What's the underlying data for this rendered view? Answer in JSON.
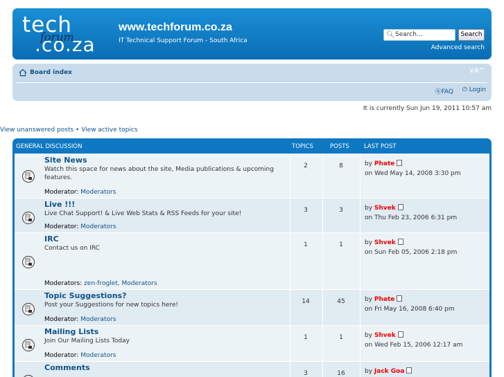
{
  "header": {
    "logo": {
      "line1": "tech",
      "line2": "forum",
      "line3": ".co.za"
    },
    "site_title": "www.techforum.co.za",
    "site_description": "IT Technical Support Forum - South Africa",
    "search_placeholder": "Search…",
    "search_button": "Search",
    "advanced_search": "Advanced search"
  },
  "navbar": {
    "board_index": "Board index",
    "font_size": "∨A^",
    "faq": "FAQ",
    "login": "Login"
  },
  "current_time": "It is currently Sun Jun 19, 2011 10:57 am",
  "links_line": "View unanswered posts • View active topics",
  "forum_table": {
    "section": "GENERAL DISCUSSION",
    "col_topics": "TOPICS",
    "col_posts": "POSTS",
    "col_last_post": "LAST POST",
    "rows": [
      {
        "title": "Site News",
        "desc": "Watch this space for news about the site, Media publications & upcoming features.",
        "mod_label": "Moderator:",
        "mods": "Moderators",
        "topics": "2",
        "posts": "8",
        "by": "by",
        "author": "Phate",
        "date": "on Wed May 14, 2008 3:30 pm"
      },
      {
        "title": "Live !!!",
        "desc": "Live Chat Support! & Live Web Stats & RSS Feeds for your site!",
        "mod_label": "Moderator:",
        "mods": "Moderators",
        "topics": "3",
        "posts": "3",
        "by": "by",
        "author": "Shvek",
        "date": "on Thu Feb 23, 2006 6:31 pm"
      },
      {
        "title": "IRC",
        "desc": "Contact us on IRC",
        "mod_label": "Moderators:",
        "mods": "zen-froglet, Moderators",
        "topics": "1",
        "posts": "1",
        "by": "by",
        "author": "Shvek",
        "date": "on Sun Feb 05, 2006 2:18 pm"
      },
      {
        "title": "Topic Suggestions?",
        "desc": "Post your Suggestions for new topics here!",
        "mod_label": "Moderator:",
        "mods": "Moderators",
        "topics": "14",
        "posts": "45",
        "by": "by",
        "author": "Phate",
        "date": "on Fri May 16, 2008 6:40 pm"
      },
      {
        "title": "Mailing Lists",
        "desc": "Join Our Mailing Lists Today",
        "mod_label": "Moderator:",
        "mods": "Moderators",
        "topics": "1",
        "posts": "1",
        "by": "by",
        "author": "Shvek",
        "date": "on Wed Feb 15, 2006 12:17 am"
      },
      {
        "title": "Comments",
        "desc": "",
        "mod_label": "",
        "mods": "",
        "topics": "3",
        "posts": "16",
        "by": "by",
        "author": "Jack Goa",
        "date": ""
      }
    ]
  },
  "colors": {
    "header_blue": "#0a6db5",
    "nav_bg": "#cadceb",
    "link": "#105289",
    "author": "#e00000"
  }
}
